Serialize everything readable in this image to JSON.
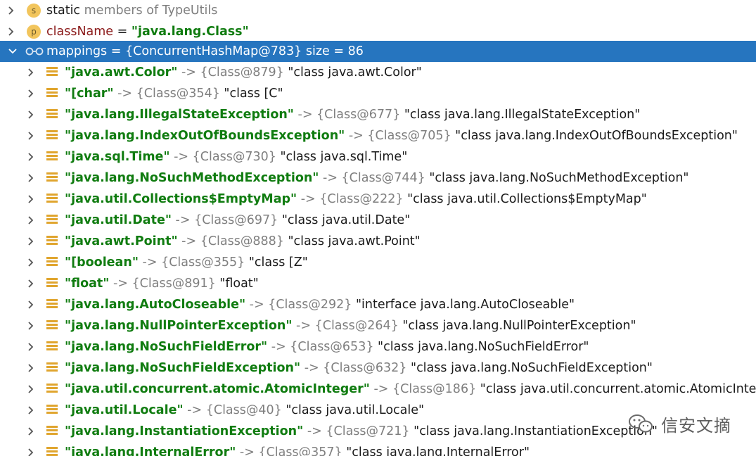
{
  "header_rows": [
    {
      "badge": "s",
      "text1": "static",
      "text2": " members of TypeUtils"
    },
    {
      "badge": "p",
      "name": "className",
      "eq": " = ",
      "value": "\"java.lang.Class\""
    },
    {
      "name": "mappings",
      "rest": " = {ConcurrentHashMap@783}  size = 86"
    }
  ],
  "entries": [
    {
      "key": "\"java.awt.Color\"",
      "arrow": " -> ",
      "ref": "{Class@879}",
      "val": " \"class java.awt.Color\""
    },
    {
      "key": "\"[char\"",
      "arrow": " -> ",
      "ref": "{Class@354}",
      "val": " \"class [C\""
    },
    {
      "key": "\"java.lang.IllegalStateException\"",
      "arrow": " -> ",
      "ref": "{Class@677}",
      "val": " \"class java.lang.IllegalStateException\""
    },
    {
      "key": "\"java.lang.IndexOutOfBoundsException\"",
      "arrow": " -> ",
      "ref": "{Class@705}",
      "val": " \"class java.lang.IndexOutOfBoundsException\""
    },
    {
      "key": "\"java.sql.Time\"",
      "arrow": " -> ",
      "ref": "{Class@730}",
      "val": " \"class java.sql.Time\""
    },
    {
      "key": "\"java.lang.NoSuchMethodException\"",
      "arrow": " -> ",
      "ref": "{Class@744}",
      "val": " \"class java.lang.NoSuchMethodException\""
    },
    {
      "key": "\"java.util.Collections$EmptyMap\"",
      "arrow": " -> ",
      "ref": "{Class@222}",
      "val": " \"class java.util.Collections$EmptyMap\""
    },
    {
      "key": "\"java.util.Date\"",
      "arrow": " -> ",
      "ref": "{Class@697}",
      "val": " \"class java.util.Date\""
    },
    {
      "key": "\"java.awt.Point\"",
      "arrow": " -> ",
      "ref": "{Class@888}",
      "val": " \"class java.awt.Point\""
    },
    {
      "key": "\"[boolean\"",
      "arrow": " -> ",
      "ref": "{Class@355}",
      "val": " \"class [Z\""
    },
    {
      "key": "\"float\"",
      "arrow": " -> ",
      "ref": "{Class@891}",
      "val": " \"float\""
    },
    {
      "key": "\"java.lang.AutoCloseable\"",
      "arrow": " -> ",
      "ref": "{Class@292}",
      "val": " \"interface java.lang.AutoCloseable\""
    },
    {
      "key": "\"java.lang.NullPointerException\"",
      "arrow": " -> ",
      "ref": "{Class@264}",
      "val": " \"class java.lang.NullPointerException\""
    },
    {
      "key": "\"java.lang.NoSuchFieldError\"",
      "arrow": " -> ",
      "ref": "{Class@653}",
      "val": " \"class java.lang.NoSuchFieldError\""
    },
    {
      "key": "\"java.lang.NoSuchFieldException\"",
      "arrow": " -> ",
      "ref": "{Class@632}",
      "val": " \"class java.lang.NoSuchFieldException\""
    },
    {
      "key": "\"java.util.concurrent.atomic.AtomicInteger\"",
      "arrow": " -> ",
      "ref": "{Class@186}",
      "val": " \"class java.util.concurrent.atomic.AtomicInteger\""
    },
    {
      "key": "\"java.util.Locale\"",
      "arrow": " -> ",
      "ref": "{Class@40}",
      "val": " \"class java.util.Locale\""
    },
    {
      "key": "\"java.lang.InstantiationException\"",
      "arrow": " -> ",
      "ref": "{Class@721}",
      "val": " \"class java.lang.InstantiationException\""
    },
    {
      "key": "\"java.lang.InternalError\"",
      "arrow": " -> ",
      "ref": "{Class@357}",
      "val": " \"class java.lang.InternalError\""
    }
  ],
  "watermark": {
    "text": "信安文摘"
  },
  "colors": {
    "selection": "#2675bf",
    "key_green": "#107c10",
    "field_name": "#8b1a1a",
    "ref_grey": "#7f7f7f",
    "badge_yellow": "#f2c55c",
    "entry_icon": "#e0a52e"
  },
  "icons": {
    "expand": "chevron-right-icon",
    "collapse": "chevron-down-icon",
    "static": "static-badge-icon",
    "field": "field-badge-icon",
    "watch": "glasses-icon",
    "entry": "map-entry-icon"
  }
}
